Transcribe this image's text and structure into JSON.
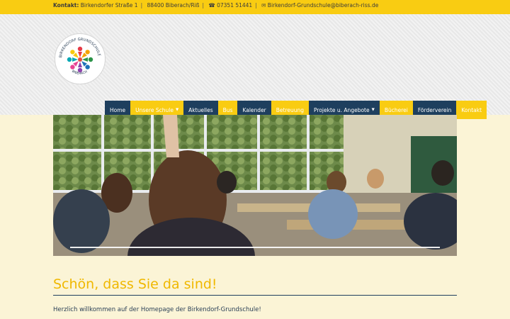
{
  "topbar": {
    "label": "Kontakt:",
    "address": "Birkendorfer Straße 1",
    "city": "88400 Biberach/Riß",
    "phone_icon": "phone-icon",
    "phone": "☎ 07351 51441",
    "mail_icon": "mail-icon",
    "email": "✉ Birkendorf-Grundschule@biberach-riss.de"
  },
  "logo": {
    "text_top": "BIRKENDORF GRUNDSCHULE",
    "text_bottom": "BIBERACH",
    "alt": "school-logo"
  },
  "nav": {
    "items": [
      {
        "label": "Home",
        "style": "dark",
        "dropdown": false
      },
      {
        "label": "Unsere Schule",
        "style": "yellow",
        "dropdown": true
      },
      {
        "label": "Aktuelles",
        "style": "dark",
        "dropdown": false
      },
      {
        "label": "Bus",
        "style": "yellow",
        "dropdown": false
      },
      {
        "label": "Kalender",
        "style": "dark",
        "dropdown": false
      },
      {
        "label": "Betreuung",
        "style": "yellow",
        "dropdown": false
      },
      {
        "label": "Projekte u. Angebote",
        "style": "dark",
        "dropdown": true
      },
      {
        "label": "Bücherei",
        "style": "yellow",
        "dropdown": false
      },
      {
        "label": "Förderverein",
        "style": "dark",
        "dropdown": false
      },
      {
        "label": "Kontakt",
        "style": "yellow",
        "dropdown": false
      }
    ]
  },
  "hero": {
    "slider_progress": 1.0
  },
  "content": {
    "welcome_title": "Schön, dass Sie da sind!",
    "intro": "Herzlich willkommen auf der Homepage der Birkendorf-Grundschule!"
  },
  "colors": {
    "yellow": "#f9cc12",
    "navy": "#1e3f5e",
    "cream": "#fbf4d6",
    "title": "#f0b800"
  }
}
